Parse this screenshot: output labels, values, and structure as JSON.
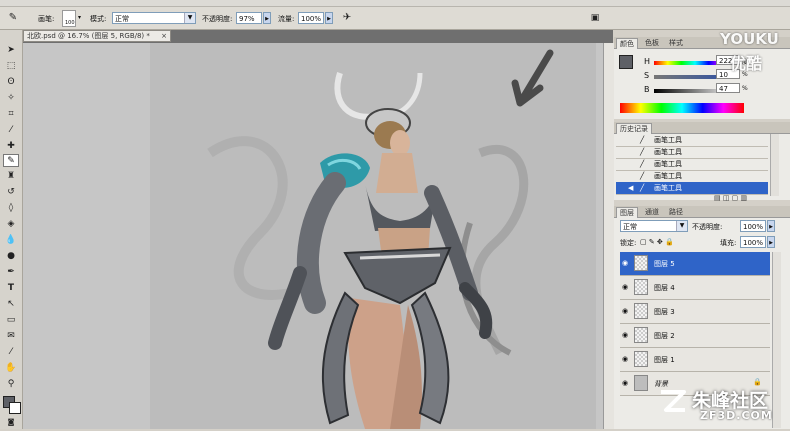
{
  "options_bar": {
    "brush_label": "画笔:",
    "brush_size": "100",
    "mode_label": "模式:",
    "mode_value": "正常",
    "opacity_label": "不透明度:",
    "opacity_value": "97%",
    "flow_label": "流量:",
    "flow_value": "100%"
  },
  "document": {
    "tab_title": "北欧.psd @ 16.7% (图层 5, RGB/8) *"
  },
  "color_panel": {
    "tabs": [
      "颜色",
      "色板",
      "样式"
    ],
    "channels": [
      {
        "label": "H",
        "value": "222",
        "unit": "度"
      },
      {
        "label": "S",
        "value": "10",
        "unit": "%"
      },
      {
        "label": "B",
        "value": "47",
        "unit": "%"
      }
    ]
  },
  "history_panel": {
    "tab": "历史记录",
    "items": [
      "画笔工具",
      "画笔工具",
      "画笔工具",
      "画笔工具",
      "画笔工具"
    ],
    "selected_index": 4
  },
  "layers_panel": {
    "tabs": [
      "图层",
      "通道",
      "路径"
    ],
    "blend_mode": "正常",
    "opacity_label": "不透明度:",
    "opacity_value": "100%",
    "lock_label": "锁定:",
    "fill_label": "填充:",
    "fill_value": "100%",
    "layers": [
      {
        "name": "图层 5",
        "selected": true
      },
      {
        "name": "图层 4",
        "selected": false
      },
      {
        "name": "图层 3",
        "selected": false
      },
      {
        "name": "图层 2",
        "selected": false
      },
      {
        "name": "图层 1",
        "selected": false
      },
      {
        "name": "背景",
        "selected": false
      }
    ]
  },
  "watermarks": {
    "youku_en": "YOUKU",
    "youku_cn": "优酷",
    "zf_cn": "朱峰社区",
    "zf_url": "ZF3D.COM"
  },
  "icons": {
    "tools": [
      "move-icon",
      "marquee-icon",
      "lasso-icon",
      "magic-wand-icon",
      "crop-icon",
      "eyedropper-icon",
      "healing-icon",
      "brush-icon",
      "clone-stamp-icon",
      "history-brush-icon",
      "eraser-icon",
      "paint-bucket-icon",
      "blur-icon",
      "dodge-icon",
      "pen-icon",
      "type-icon",
      "path-select-icon",
      "shape-icon",
      "notes-icon",
      "eyedropper2-icon",
      "hand-icon",
      "zoom-icon"
    ]
  },
  "colors": {
    "accent": "#2f64c8",
    "foreground": "#5e6066",
    "background": "#ffffff"
  }
}
